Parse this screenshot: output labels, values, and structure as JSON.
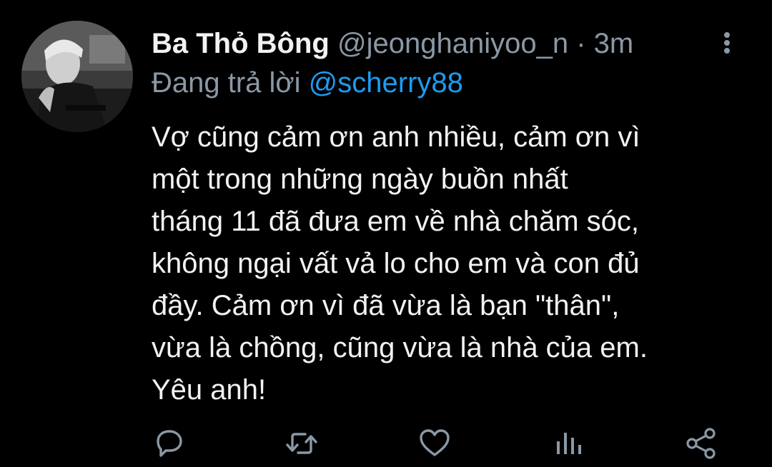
{
  "tweet": {
    "display_name": "Ba Thỏ Bông",
    "handle": "@jeonghaniyoo_n",
    "separator": "·",
    "time": "3m",
    "reply_prefix": "Đang trả lời",
    "reply_to": "@scherry88",
    "text_lines": [
      "Vợ cũng cảm ơn anh nhiều, cảm ơn vì",
      "một trong những ngày buồn nhất",
      "tháng 11 đã đưa em về nhà chăm sóc,",
      "không ngại vất vả lo cho em và con đủ",
      "đầy. Cảm ơn vì đã vừa là bạn \"thân\",",
      "vừa là chồng, cũng vừa là nhà của em.",
      "Yêu anh!"
    ]
  },
  "icons": {
    "more": "more-vertical-icon",
    "reply": "reply-icon",
    "retweet": "retweet-icon",
    "like": "like-icon",
    "analytics": "analytics-icon",
    "share": "share-icon"
  },
  "colors": {
    "background": "#000000",
    "primary_text": "#f2f2f2",
    "secondary_text": "#8b98a5",
    "link": "#1d9bf0"
  }
}
